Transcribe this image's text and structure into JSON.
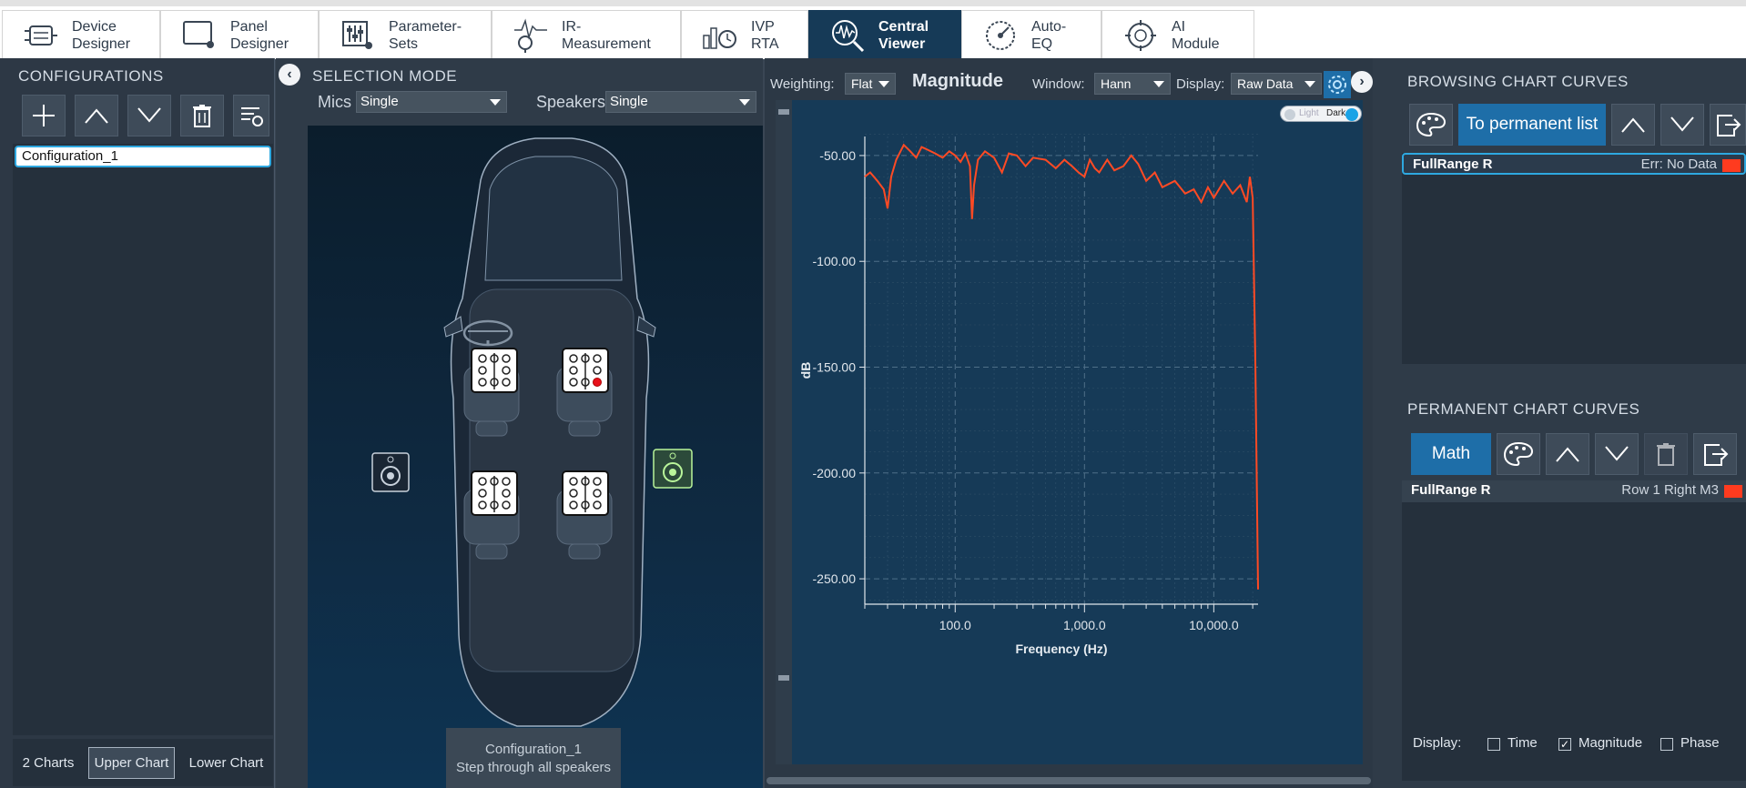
{
  "tabs": [
    {
      "label": "Device\nDesigner",
      "icon": "device-icon"
    },
    {
      "label": "Panel\nDesigner",
      "icon": "panel-icon"
    },
    {
      "label": "Parameter-\nSets",
      "icon": "sliders-icon"
    },
    {
      "label": "IR-\nMeasurement",
      "icon": "microphone-icon"
    },
    {
      "label": "IVP\nRTA",
      "icon": "rta-icon"
    },
    {
      "label": "Central\nViewer",
      "icon": "viewer-icon"
    },
    {
      "label": "Auto-\nEQ",
      "icon": "gauge-icon"
    },
    {
      "label": "AI\nModule",
      "icon": "ai-icon"
    }
  ],
  "configurations": {
    "title": "CONFIGURATIONS",
    "items": [
      "Configuration_1"
    ],
    "bottom_tabs": [
      "2 Charts",
      "Upper Chart",
      "Lower Chart"
    ]
  },
  "selection": {
    "title": "SELECTION MODE",
    "mics_label": "Mics",
    "mics_value": "Single",
    "speakers_label": "Speakers",
    "speakers_value": "Single",
    "card_line1": "Configuration_1",
    "card_line2": "Step through all speakers"
  },
  "chart_controls": {
    "weighting_label": "Weighting:",
    "weighting_value": "Flat",
    "title": "Magnitude",
    "window_label": "Window:",
    "window_value": "Hann",
    "display_label": "Display:",
    "display_value": "Raw Data",
    "toggle_light": "Light",
    "toggle_dark": "Dark"
  },
  "chart_data": {
    "type": "line",
    "title": "Magnitude",
    "xlabel": "Frequency (Hz)",
    "ylabel": "dB",
    "x_scale": "log",
    "xlim": [
      20,
      22000
    ],
    "ylim": [
      -262,
      -41
    ],
    "x_ticks": [
      100,
      1000,
      10000
    ],
    "x_tick_labels": [
      "100.0",
      "1,000.0",
      "10,000.0"
    ],
    "y_ticks": [
      -50,
      -100,
      -150,
      -200,
      -250
    ],
    "y_tick_labels": [
      "-50.00",
      "-100.00",
      "-150.00",
      "-200.00",
      "-250.00"
    ],
    "grid": true,
    "series": [
      {
        "name": "FullRange R",
        "color": "#ff4a24",
        "x": [
          20,
          22,
          25,
          28,
          30,
          32,
          35,
          40,
          45,
          50,
          55,
          60,
          70,
          80,
          90,
          100,
          110,
          120,
          130,
          135,
          140,
          150,
          170,
          200,
          230,
          260,
          300,
          350,
          400,
          500,
          600,
          700,
          800,
          900,
          1000,
          1100,
          1200,
          1300,
          1500,
          1700,
          2000,
          2300,
          2600,
          3000,
          3500,
          4000,
          5000,
          6000,
          7000,
          8000,
          9000,
          10000,
          12000,
          14000,
          16000,
          18000,
          19000,
          20000,
          21000,
          22000
        ],
        "y": [
          -60,
          -58,
          -62,
          -66,
          -75,
          -60,
          -52,
          -45,
          -48,
          -51,
          -46,
          -47,
          -49,
          -51,
          -48,
          -50,
          -53,
          -49,
          -55,
          -80,
          -64,
          -52,
          -48,
          -51,
          -58,
          -49,
          -50,
          -55,
          -51,
          -52,
          -56,
          -52,
          -55,
          -58,
          -60,
          -52,
          -56,
          -58,
          -52,
          -57,
          -55,
          -50,
          -54,
          -62,
          -58,
          -65,
          -62,
          -68,
          -66,
          -72,
          -65,
          -70,
          -62,
          -68,
          -64,
          -72,
          -60,
          -70,
          -150,
          -255
        ]
      }
    ]
  },
  "browsing": {
    "title": "BROWSING CHART CURVES",
    "to_permanent_label": "To permanent list",
    "curves": [
      {
        "name": "FullRange R",
        "status": "Err: No Data",
        "color": "#ff3b1f"
      }
    ]
  },
  "permanent": {
    "title": "PERMANENT CHART CURVES",
    "math_label": "Math",
    "curves": [
      {
        "name": "FullRange R",
        "status": "Row 1 Right M3",
        "color": "#ff3b1f"
      }
    ]
  },
  "display_options": {
    "label": "Display:",
    "time_label": "Time",
    "time_checked": false,
    "magnitude_label": "Magnitude",
    "magnitude_checked": true,
    "phase_label": "Phase",
    "phase_checked": false
  }
}
